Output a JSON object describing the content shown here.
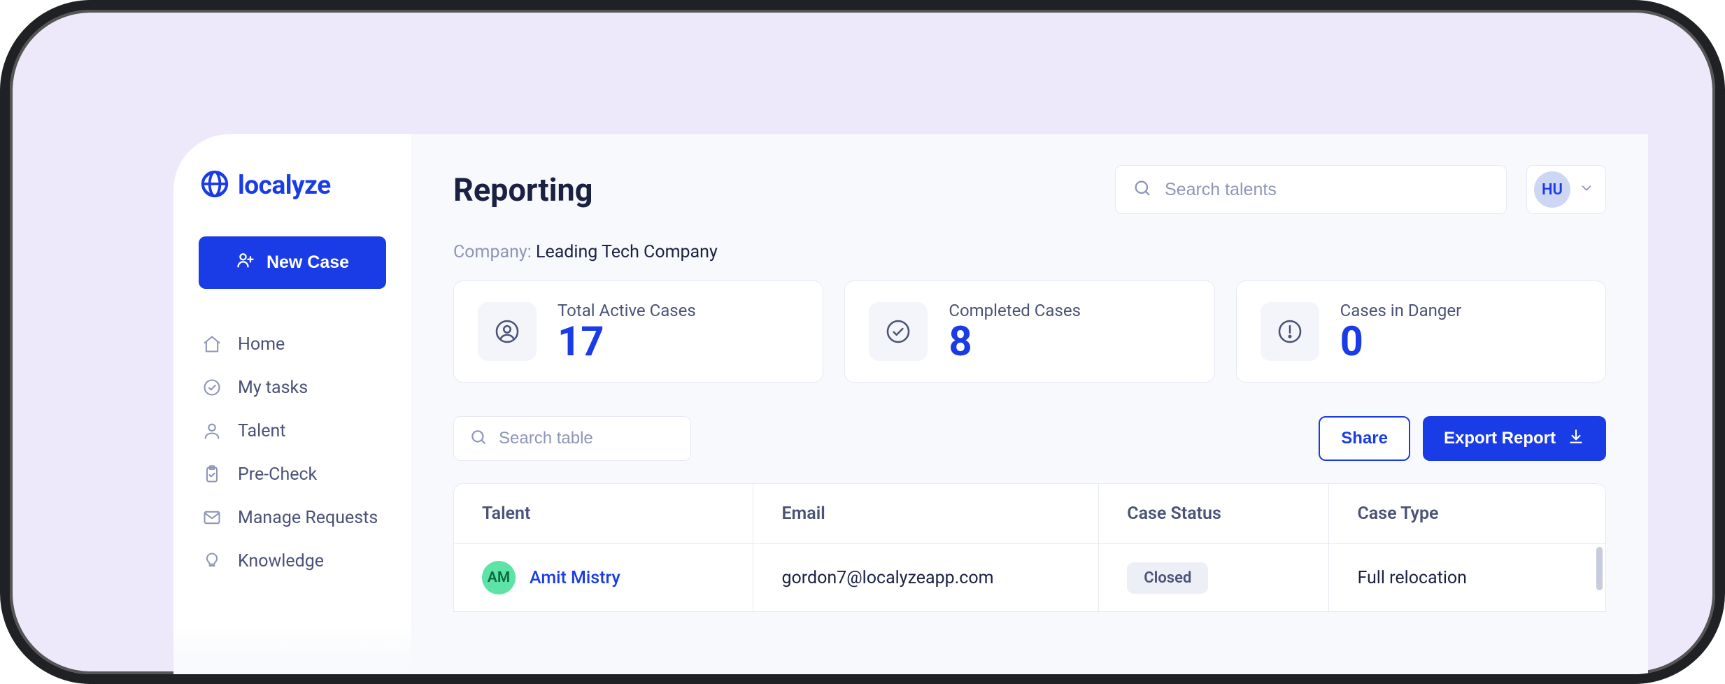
{
  "brand": {
    "name": "localyze"
  },
  "sidebar": {
    "new_case": "New Case",
    "items": [
      {
        "label": "Home"
      },
      {
        "label": "My tasks"
      },
      {
        "label": "Talent"
      },
      {
        "label": "Pre-Check"
      },
      {
        "label": "Manage Requests"
      },
      {
        "label": "Knowledge"
      }
    ]
  },
  "header": {
    "title": "Reporting",
    "search_placeholder": "Search talents",
    "user_initials": "HU"
  },
  "company": {
    "prefix": "Company: ",
    "name": "Leading Tech Company"
  },
  "stats": [
    {
      "label": "Total Active Cases",
      "value": "17"
    },
    {
      "label": "Completed Cases",
      "value": "8"
    },
    {
      "label": "Cases in Danger",
      "value": "0"
    }
  ],
  "table_controls": {
    "search_placeholder": "Search table",
    "share": "Share",
    "export": "Export Report"
  },
  "table": {
    "columns": [
      "Talent",
      "Email",
      "Case Status",
      "Case Type"
    ],
    "rows": [
      {
        "initials": "AM",
        "name": "Amit Mistry",
        "email": "gordon7@localyzeapp.com",
        "status": "Closed",
        "case_type": "Full relocation"
      }
    ]
  }
}
